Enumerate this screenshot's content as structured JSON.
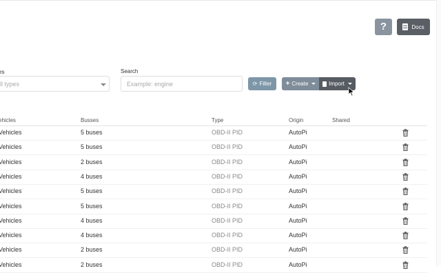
{
  "header": {
    "help_label": "?",
    "docs_label": "Docs"
  },
  "filters": {
    "types_label": "es",
    "types_value": "ll types",
    "search_label": "Search",
    "search_placeholder": "Example: engine",
    "filter_label": "Filter",
    "create_label": "Create",
    "import_label": "Import"
  },
  "table": {
    "columns": [
      "ehicles",
      "Busses",
      "Type",
      "Origin",
      "Shared"
    ],
    "rows": [
      {
        "vehicles": "Vehicles",
        "busses": "5 buses",
        "type": "OBD-II PID",
        "origin": "AutoPi"
      },
      {
        "vehicles": "Vehicles",
        "busses": "5 buses",
        "type": "OBD-II PID",
        "origin": "AutoPi"
      },
      {
        "vehicles": "Vehicles",
        "busses": "2 buses",
        "type": "OBD-II PID",
        "origin": "AutoPi"
      },
      {
        "vehicles": "Vehicles",
        "busses": "4 buses",
        "type": "OBD-II PID",
        "origin": "AutoPi"
      },
      {
        "vehicles": "Vehicles",
        "busses": "5 buses",
        "type": "OBD-II PID",
        "origin": "AutoPi"
      },
      {
        "vehicles": "Vehicles",
        "busses": "5 buses",
        "type": "OBD-II PID",
        "origin": "AutoPi"
      },
      {
        "vehicles": "Vehicles",
        "busses": "4 buses",
        "type": "OBD-II PID",
        "origin": "AutoPi"
      },
      {
        "vehicles": "Vehicles",
        "busses": "4 buses",
        "type": "OBD-II PID",
        "origin": "AutoPi"
      },
      {
        "vehicles": "Vehicles",
        "busses": "2 buses",
        "type": "OBD-II PID",
        "origin": "AutoPi"
      },
      {
        "vehicles": "Vehicles",
        "busses": "2 buses",
        "type": "OBD-II PID",
        "origin": "AutoPi"
      }
    ]
  },
  "icons": {
    "delete": "trash-icon",
    "refresh": "refresh-icon",
    "plus": "plus-icon",
    "file": "file-icon",
    "docs": "book-icon"
  }
}
